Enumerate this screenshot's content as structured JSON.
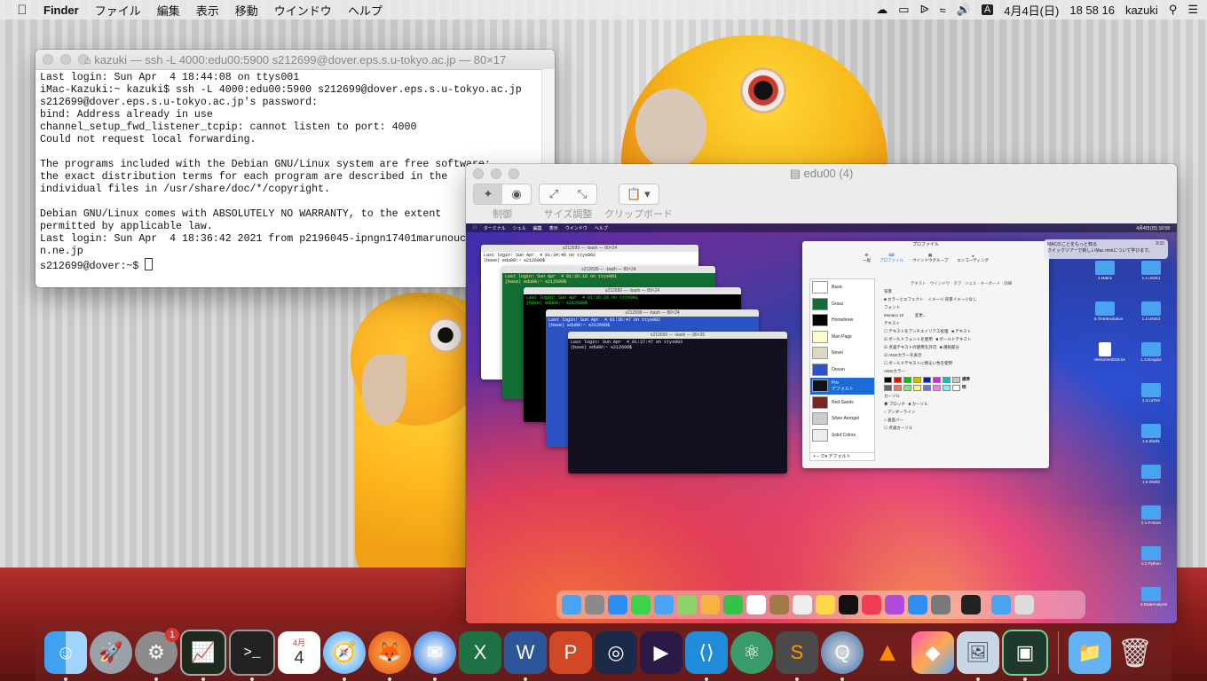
{
  "menubar": {
    "app": "Finder",
    "items": [
      "ファイル",
      "編集",
      "表示",
      "移動",
      "ウインドウ",
      "ヘルプ"
    ],
    "ime": "A",
    "date": "4月4日(日)",
    "time": "18 58 16",
    "user": "kazuki"
  },
  "terminal": {
    "title": "kazuki — ssh -L 4000:edu00:5900 s212699@dover.eps.s.u-tokyo.ac.jp — 80×17",
    "lines": [
      "Last login: Sun Apr  4 18:44:08 on ttys001",
      "iMac-Kazuki:~ kazuki$ ssh -L 4000:edu00:5900 s212699@dover.eps.s.u-tokyo.ac.jp",
      "s212699@dover.eps.s.u-tokyo.ac.jp's password:",
      "bind: Address already in use",
      "channel_setup_fwd_listener_tcpip: cannot listen to port: 4000",
      "Could not request local forwarding.",
      "",
      "The programs included with the Debian GNU/Linux system are free software;",
      "the exact distribution terms for each program are described in the",
      "individual files in /usr/share/doc/*/copyright.",
      "",
      "Debian GNU/Linux comes with ABSOLUTELY NO WARRANTY, to the extent",
      "permitted by applicable law.",
      "Last login: Sun Apr  4 18:36:42 2021 from p2196045-ipngn17401marunouchi.tokyo.ocn.ne.jp",
      "n.ne.jp"
    ],
    "prompt": "s212699@dover:~$ "
  },
  "vnc": {
    "title": "edu00 (4)",
    "toolbar": {
      "control_label": "制御",
      "resize_label": "サイズ調整",
      "clipboard_label": "クリップボード"
    },
    "remote": {
      "menubar": [
        "ターミナル",
        "シェル",
        "編集",
        "表示",
        "ウインドウ",
        "ヘルプ"
      ],
      "clock": "4月4日(日) 16:58",
      "terms": [
        {
          "title": "s212699 — -bash — 80×24",
          "text": "Last login: Sun Apr  4 01:34:46 on ttys002\n(base) edu00:~ s212699$ "
        },
        {
          "title": "s212699 — -bash — 80×24",
          "text": "Last login: Sun Apr  4 01:36:18 on ttys001\n(base) edu00:~ s212699$ "
        },
        {
          "title": "s212699 — -bash — 80×24",
          "text": "Last login: Sun Apr  4 01:36:28 on ttys001\n(base) edu00:~ s212699$ "
        },
        {
          "title": "s212699 — -bash — 80×24",
          "text": "Last login: Sun Apr  4 01:36:47 on ttys002\n(base) edu00:~ s212699$ "
        },
        {
          "title": "s212699 — -bash — 95×25",
          "text": "Last login: Sun Apr  4 01:37:47 on ttys003\n(base) edu00:~ s212699$ "
        }
      ],
      "prefs": {
        "title": "プロファイル",
        "tabs": [
          "一般",
          "プロファイル",
          "ウインドウグループ",
          "エンコーディング"
        ],
        "profiles": [
          "Basic",
          "Grass",
          "Homebrew",
          "Man Page",
          "Novel",
          "Ocean",
          "Pro",
          "Red Sands",
          "Silver Aerogel",
          "Solid Colors"
        ],
        "selected_sub": "デフォルト",
        "subtabs": [
          "テキスト",
          "ウインドウ",
          "タブ",
          "シェル",
          "キーボード",
          "詳細"
        ],
        "background_label": "背景",
        "color_effect": "カラーとエフェクト",
        "image_label": "イメージ",
        "image_value": "背景イメージなし",
        "font_label": "フォント",
        "font_value": "Monaco 10",
        "change_button": "変更...",
        "text_label": "テキスト",
        "checks": [
          "テキストをアンチエイリアス処理",
          "ボールドフォントを使用",
          "点滅テキストの使用を許可",
          "ANSIカラーを表示",
          "ボールドテキストに明るい色を使用"
        ],
        "text_swatches": [
          "テキスト",
          "ボールドテキスト",
          "選択部分"
        ],
        "ansi_label": "ANSIカラー",
        "ansi_rows": [
          "標準",
          "明"
        ],
        "cursor_label": "カーソル",
        "cursor_options": [
          "ブロック",
          "アンダーライン",
          "垂直バー",
          "点滅カーソル"
        ],
        "cursor_swatch": "カーソル",
        "default_button": "デフォルト"
      },
      "notification": {
        "title": "MACのことをもっと知る",
        "time": "9:32",
        "body": "クイックツアーで新しいMac miniについて学びます。"
      },
      "desktop_items": [
        "4.Matrix",
        "1.1.UNIX1",
        "5.TimeEvolution",
        "1.2.UNIX2",
        "Welcome2019.txt",
        "1.3.Gnuplot",
        "1.4.LaTeX",
        "1.5.Shell1",
        "1.6.Shell2",
        "2.1.Fortran",
        "2.2.Python",
        "3.DataAnalysis"
      ]
    }
  },
  "dock": {
    "apps": [
      "Finder",
      "Launchpad",
      "System Preferences",
      "Activity Monitor",
      "Terminal",
      "Calendar",
      "Safari",
      "Firefox",
      "Thunderbird",
      "Excel",
      "Word",
      "PowerPoint",
      "Screen Capture",
      "Video Editor",
      "Visual Studio Code",
      "Atom",
      "Sublime Text",
      "QuickTime",
      "VLC",
      "Grapher",
      "Preview",
      "Screen Sharing",
      "Documents",
      "Trash"
    ],
    "prefs_badge": "1",
    "calendar_month": "4月",
    "calendar_day": "4"
  },
  "colors": {
    "accent": "#1a6cd8",
    "rail": "#8f1f1d",
    "badge": "#e0332b"
  }
}
